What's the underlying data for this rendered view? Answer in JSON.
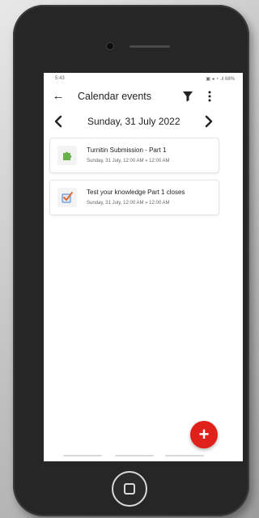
{
  "status_bar": {
    "time": "5:43",
    "icons_text": "▣ ◂ ◔ .ıl 68%"
  },
  "app_bar": {
    "back_icon": "arrow-left-icon",
    "title": "Calendar events",
    "filter_icon": "filter-icon",
    "more_icon": "more-vertical-icon"
  },
  "date_nav": {
    "prev_icon": "chevron-left-icon",
    "date": "Sunday, 31 July 2022",
    "next_icon": "chevron-right-icon"
  },
  "events": [
    {
      "title": "Turnitin Submission - Part 1",
      "time": "Sunday, 31 July, 12:00 AM » 12:00 AM",
      "icon": "puzzle-icon",
      "icon_color": "#6ab04c"
    },
    {
      "title": "Test your knowledge Part 1 closes",
      "time": "Sunday, 31 July, 12:00 AM » 12:00 AM",
      "icon": "quiz-checkbox-icon",
      "icon_color": "#4a7fd1"
    }
  ],
  "fab": {
    "label": "+",
    "color": "#e0201b"
  },
  "colors": {
    "phone_body": "#262626",
    "screen_bg": "#ffffff",
    "text_primary": "#222222",
    "text_secondary": "#666666"
  }
}
